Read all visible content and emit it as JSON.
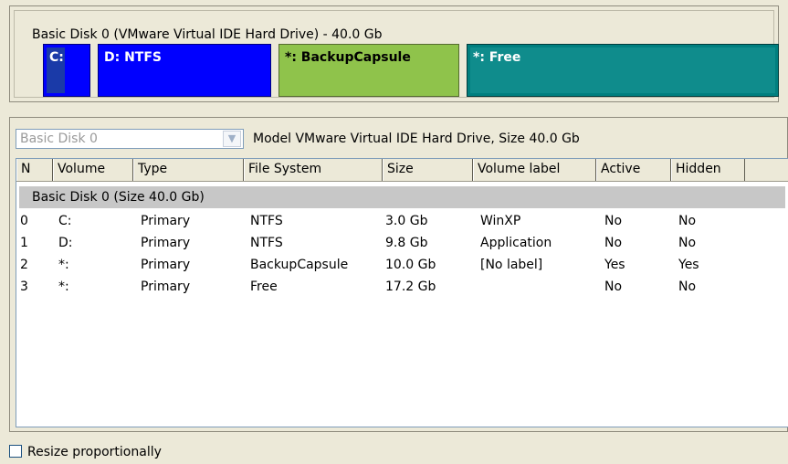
{
  "disk_map": {
    "title": "Basic Disk 0 (VMware Virtual IDE Hard Drive) - 40.0 Gb",
    "partitions": [
      {
        "label": "C:",
        "color": "#0000ff"
      },
      {
        "label": "D: NTFS",
        "color": "#0000ff"
      },
      {
        "label": "*: BackupCapsule",
        "color": "#8fc34b"
      },
      {
        "label": "*: Free",
        "color": "#007f7f"
      }
    ]
  },
  "disk_selector": {
    "value": "Basic Disk 0",
    "model_info": "Model VMware Virtual IDE Hard Drive, Size 40.0 Gb"
  },
  "table": {
    "columns": [
      "N",
      "Volume",
      "Type",
      "File System",
      "Size",
      "Volume label",
      "Active",
      "Hidden"
    ],
    "group_label": "Basic Disk 0 (Size 40.0 Gb)",
    "rows": [
      {
        "n": "0",
        "volume": "C:",
        "type": "Primary",
        "fs": "NTFS",
        "size": "3.0 Gb",
        "label": "WinXP",
        "active": "No",
        "hidden": "No"
      },
      {
        "n": "1",
        "volume": "D:",
        "type": "Primary",
        "fs": "NTFS",
        "size": "9.8 Gb",
        "label": "Application",
        "active": "No",
        "hidden": "No"
      },
      {
        "n": "2",
        "volume": "*:",
        "type": "Primary",
        "fs": "BackupCapsule",
        "size": "10.0 Gb",
        "label": "[No label]",
        "active": "Yes",
        "hidden": "Yes"
      },
      {
        "n": "3",
        "volume": "*:",
        "type": "Primary",
        "fs": "Free",
        "size": "17.2 Gb",
        "label": "",
        "active": "No",
        "hidden": "No"
      }
    ]
  },
  "options": {
    "resize_label": "Resize proportionally",
    "resize_checked": false
  }
}
